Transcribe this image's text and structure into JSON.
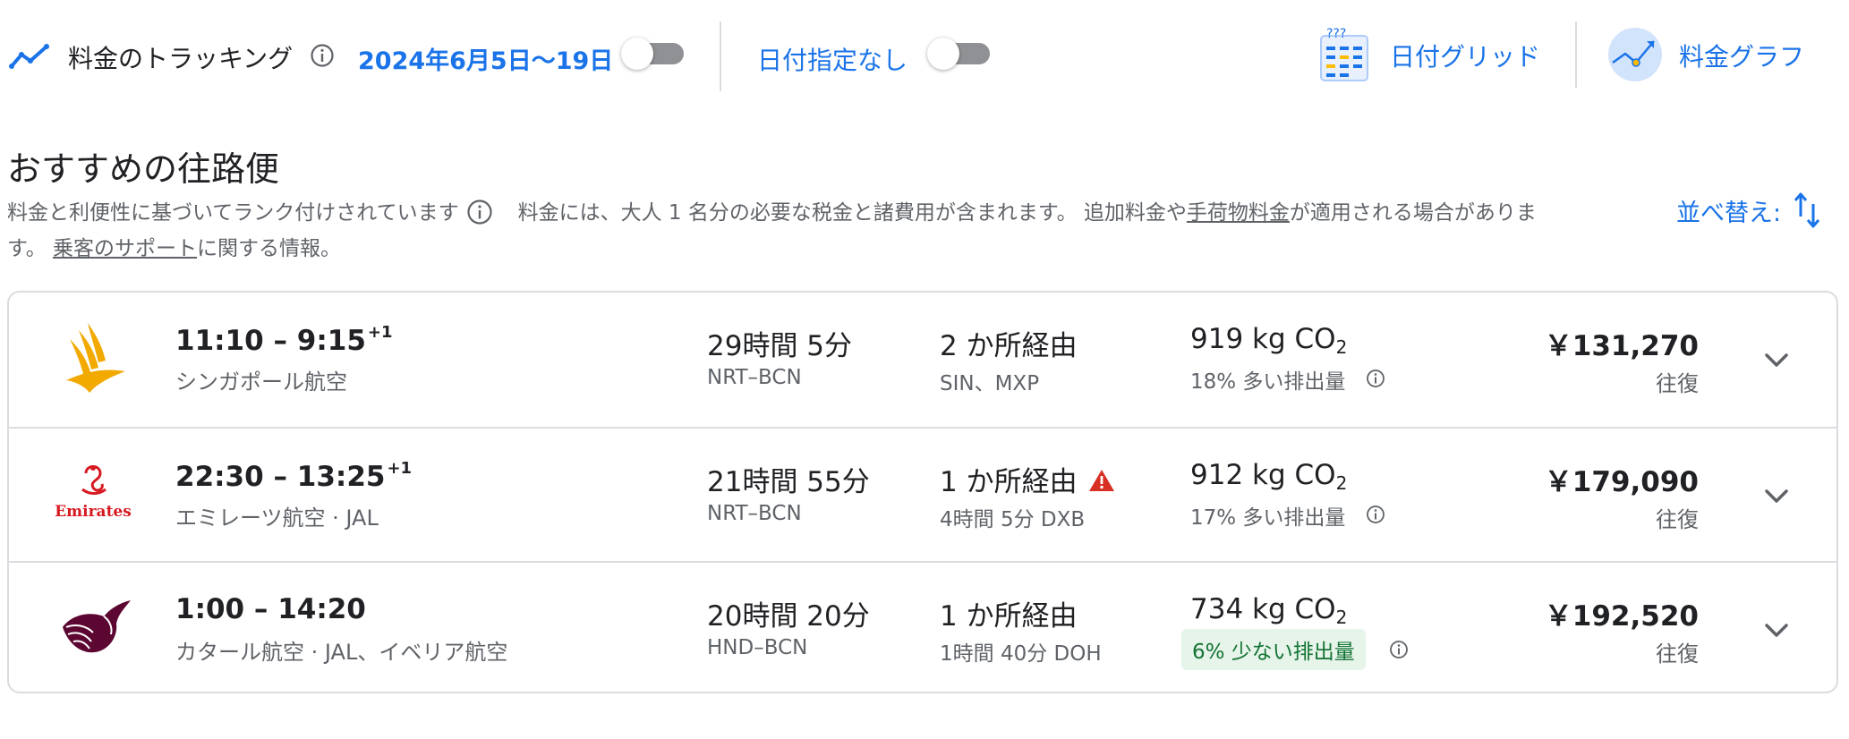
{
  "tracking": {
    "label": "料金のトラッキング",
    "date_range": "2024年6月5日〜19日",
    "date_toggle_on": false,
    "no_date_label": "日付指定なし",
    "no_date_toggle_on": false
  },
  "views": {
    "date_grid_label": "日付グリッド",
    "price_graph_label": "料金グラフ"
  },
  "section": {
    "title": "おすすめの往路便",
    "ranking_note": "料金と利便性に基づいてランク付けされています",
    "fare_note_pre": "料金には、大人 1 名分の必要な税金と諸費用が含まれます。 追加料金や",
    "baggage_link": "手荷物料金",
    "fare_note_post": "が適用される場合がありま",
    "fare_note_cont": "す。 ",
    "assistance_link": "乗客のサポート",
    "assistance_post": "に関する情報。",
    "sort_label": "並べ替え:"
  },
  "colors": {
    "accent": "#1a73e8",
    "warning": "#d93025",
    "green_badge_bg": "#e6f4ea",
    "green_badge_text": "#137333"
  },
  "flights": [
    {
      "logo": "singapore-airlines-logo",
      "depart": "11:10",
      "arrive": "9:15",
      "arrive_offset": "+1",
      "airline": "シンガポール航空",
      "duration": "29時間 5分",
      "route": "NRT–BCN",
      "stops": "2 か所経由",
      "stop_detail": "SIN、MXP",
      "co2_value": "919 kg CO",
      "co2_sub": "2",
      "emission_note": "18% 多い排出量",
      "price": "￥131,270",
      "price_type": "往復"
    },
    {
      "logo": "emirates-logo",
      "logo_text": "Emirates",
      "depart": "22:30",
      "arrive": "13:25",
      "arrive_offset": "+1",
      "airline": "エミレーツ航空 · JAL",
      "duration": "21時間 55分",
      "route": "NRT–BCN",
      "stops": "1 か所経由",
      "stop_detail": "4時間 5分 DXB",
      "co2_value": "912 kg CO",
      "co2_sub": "2",
      "emission_note": "17% 多い排出量",
      "price": "￥179,090",
      "price_type": "往復"
    },
    {
      "logo": "qatar-airways-logo",
      "depart": "1:00",
      "arrive": "14:20",
      "airline": "カタール航空 · JAL、イベリア航空",
      "duration": "20時間 20分",
      "route": "HND–BCN",
      "stops": "1 か所経由",
      "stop_detail": "1時間 40分 DOH",
      "co2_value": "734 kg CO",
      "co2_sub": "2",
      "emission_note": "6% 少ない排出量",
      "price": "￥192,520",
      "price_type": "往復"
    }
  ]
}
